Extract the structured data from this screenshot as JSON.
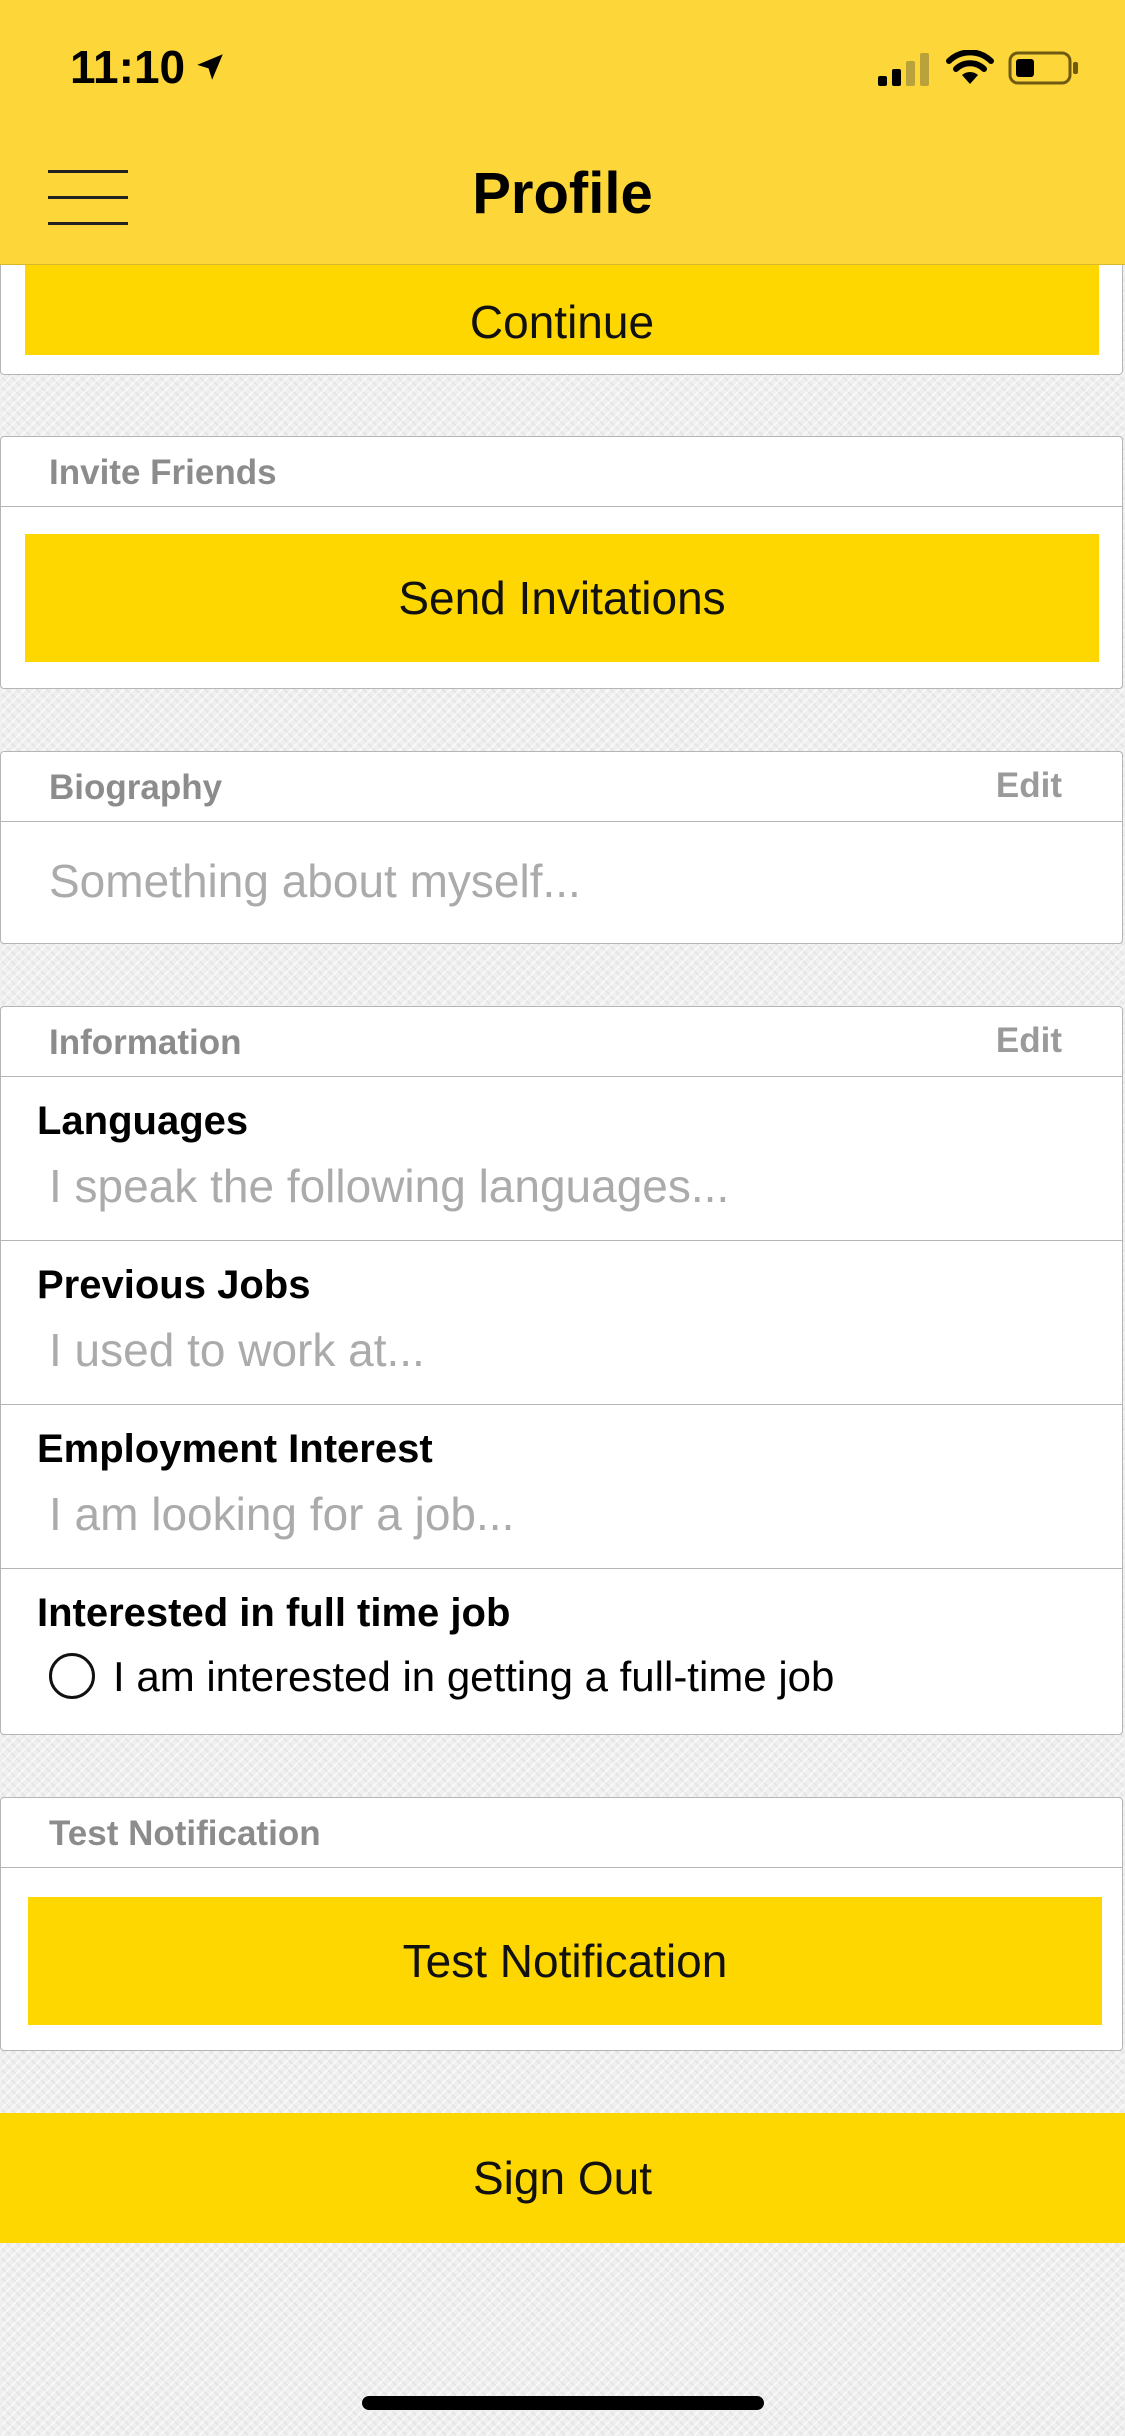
{
  "status_bar": {
    "time": "11:10"
  },
  "header": {
    "title": "Profile"
  },
  "continue_label": "Continue",
  "invite": {
    "header": "Invite Friends",
    "button": "Send Invitations"
  },
  "biography": {
    "header": "Biography",
    "edit": "Edit",
    "placeholder": "Something about myself..."
  },
  "information": {
    "header": "Information",
    "edit": "Edit",
    "languages": {
      "title": "Languages",
      "placeholder": "I speak the following languages..."
    },
    "previous_jobs": {
      "title": "Previous Jobs",
      "placeholder": "I used to work at..."
    },
    "employment": {
      "title": "Employment Interest",
      "placeholder": "I am looking for a job..."
    },
    "full_time": {
      "title": "Interested in full time job",
      "option": "I am interested in getting a full-time job"
    }
  },
  "test_notification": {
    "header": "Test Notification",
    "button": "Test Notification"
  },
  "sign_out": "Sign Out",
  "colors": {
    "header_bg": "#fdd639",
    "button_bg": "#fed700"
  }
}
